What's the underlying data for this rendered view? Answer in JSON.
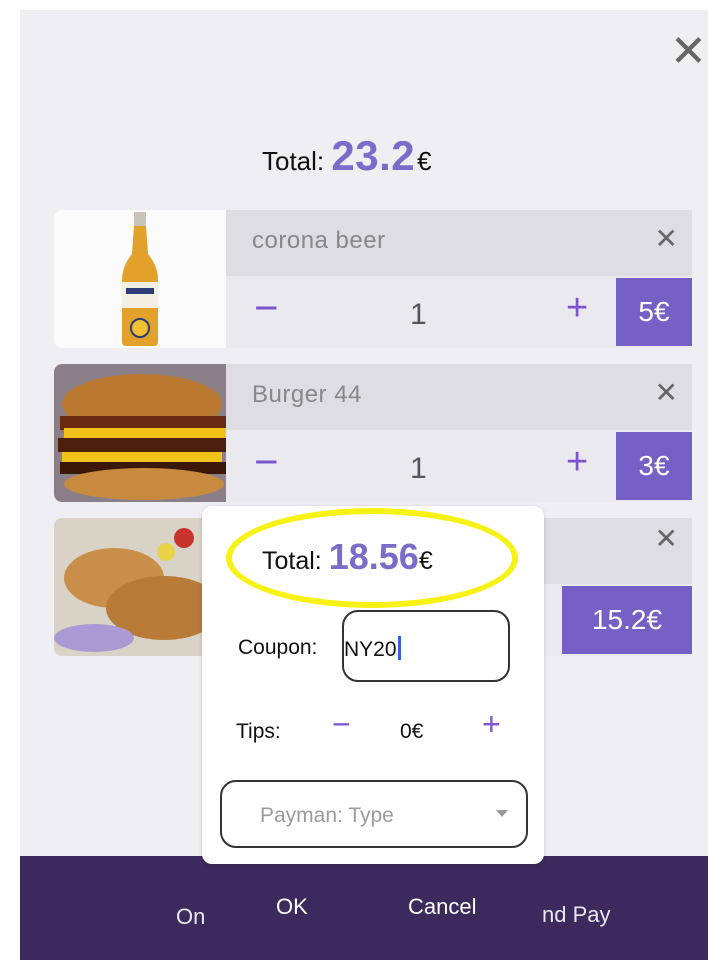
{
  "header": {
    "close_icon": "close-icon"
  },
  "total": {
    "label": "Total:",
    "value": "23.2",
    "currency": "€"
  },
  "cart": {
    "items": [
      {
        "name": "corona beer",
        "quantity": "1",
        "price": "5€",
        "minus": "−",
        "plus": "+",
        "image": "beer-bottle-image"
      },
      {
        "name": "Burger 44",
        "quantity": "1",
        "price": "3€",
        "minus": "−",
        "plus": "+",
        "image": "burger-image"
      },
      {
        "name": "",
        "quantity": "",
        "price": "15.2€",
        "minus": "",
        "plus": "",
        "image": "skewers-image"
      }
    ]
  },
  "popup": {
    "total_label": "Total:",
    "total_value": "18.56",
    "currency": "€",
    "coupon_label": "Coupon:",
    "coupon_value": "NY20",
    "tips_label": "Tips:",
    "tips_minus": "−",
    "tips_value": "0€",
    "tips_plus": "+",
    "payment_placeholder": "Payman: Type",
    "ok_label": "OK",
    "cancel_label": "Cancel"
  },
  "bottom_bar": {
    "left_text": "On",
    "right_text": "nd Pay"
  },
  "colors": {
    "accent": "#7561c6",
    "bar": "#3b2a5b",
    "highlight": "#f7f213"
  }
}
